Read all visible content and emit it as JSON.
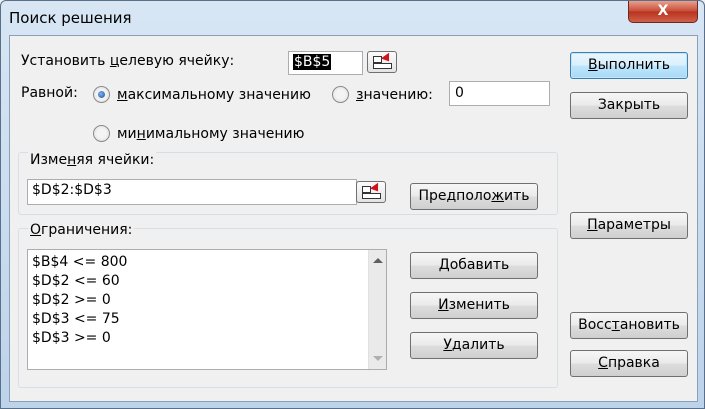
{
  "window": {
    "title": "Поиск решения",
    "close_glyph": "X"
  },
  "target": {
    "label_pre": "Установить ",
    "label_accel": "ц",
    "label_post": "елевую ячейку:",
    "value": "$B$5"
  },
  "equal": {
    "label": "Равной:",
    "max_pre": "",
    "max_accel": "м",
    "max_post": "аксимальному значению",
    "value_pre": "",
    "value_accel": "з",
    "value_post": "начению:",
    "value_input": "0",
    "min_pre": "ми",
    "min_accel": "н",
    "min_post": "имальному значению",
    "selected": "max"
  },
  "changing": {
    "label_pre": "Изме",
    "label_accel": "н",
    "label_post": "яя ячейки:",
    "value": "$D$2:$D$3",
    "guess_pre": "Предполо",
    "guess_accel": "ж",
    "guess_post": "ить"
  },
  "constraints": {
    "label_pre": "",
    "label_accel": "О",
    "label_post": "граничения:",
    "items": [
      "$B$4 <= 800",
      "$D$2 <= 60",
      "$D$2 >= 0",
      "$D$3 <= 75",
      "$D$3 >= 0"
    ],
    "add_pre": "",
    "add_accel": "Д",
    "add_post": "обавить",
    "change_pre": "",
    "change_accel": "И",
    "change_post": "зменить",
    "delete_pre": "",
    "delete_accel": "У",
    "delete_post": "далить"
  },
  "side": {
    "solve_pre": "",
    "solve_accel": "В",
    "solve_post": "ыполнить",
    "close": "Закрыть",
    "params_pre": "",
    "params_accel": "П",
    "params_post": "араметры",
    "restore_pre": "Восс",
    "restore_accel": "т",
    "restore_post": "ановить",
    "help_pre": "",
    "help_accel": "С",
    "help_post": "правка"
  }
}
